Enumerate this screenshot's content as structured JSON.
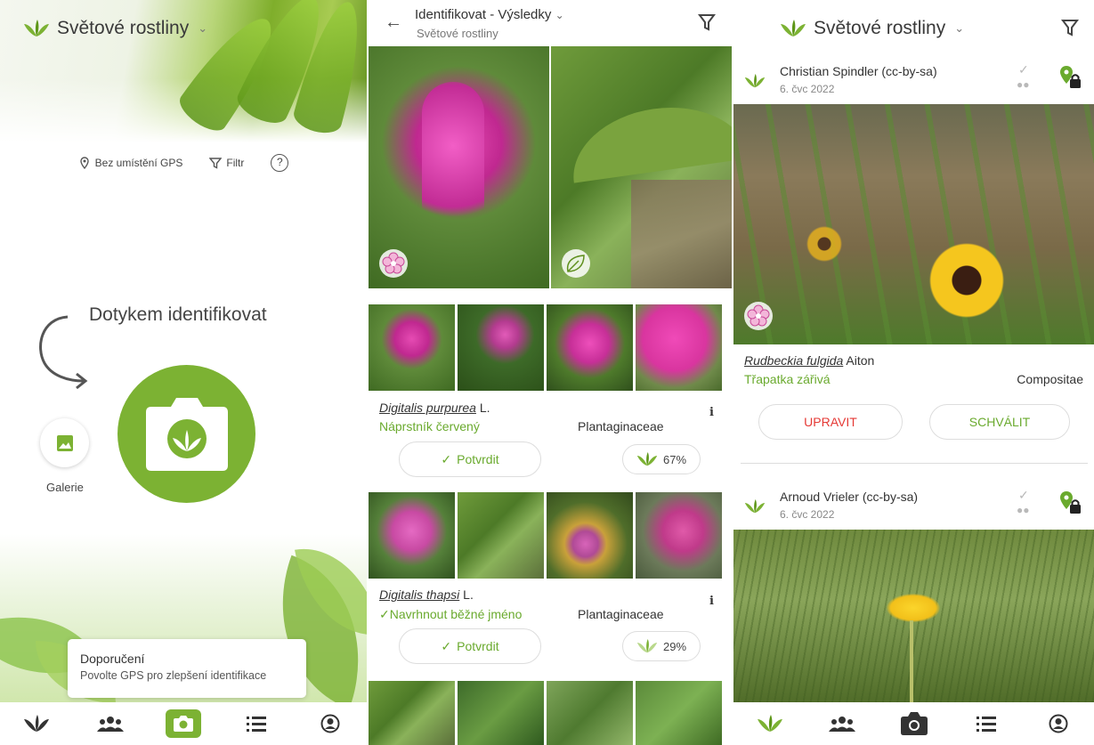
{
  "colors": {
    "accent": "#7cb233",
    "accent_text": "#6aaa2e",
    "danger": "#e53935"
  },
  "screen1": {
    "header": {
      "title": "Světové rostliny",
      "dropdown_icon": "chevron-down-icon"
    },
    "toolbar": {
      "gps_label": "Bez umístění GPS",
      "filter_label": "Filtr",
      "help_icon": "help-circle-icon"
    },
    "hint": "Dotykem identifikovat",
    "gallery_label": "Galerie",
    "toast": {
      "title": "Doporučení",
      "message": "Povolte GPS pro zlepšení identifikace"
    },
    "nav": [
      "plants-icon",
      "community-icon",
      "camera-icon",
      "list-icon",
      "profile-icon"
    ]
  },
  "screen2": {
    "header": {
      "title": "Identifikovat - Výsledky",
      "subtitle": "Světové rostliny"
    },
    "results": [
      {
        "scientific": "Digitalis purpurea",
        "author": "L.",
        "common": "Náprstník červený",
        "family": "Plantaginaceae",
        "confirm": "Potvrdit",
        "score": "67%"
      },
      {
        "scientific": "Digitalis thapsi",
        "author": "L.",
        "common": "Navrhnout běžné jméno",
        "family": "Plantaginaceae",
        "confirm": "Potvrdit",
        "score": "29%"
      }
    ]
  },
  "screen3": {
    "header": {
      "title": "Světové rostliny"
    },
    "observations": [
      {
        "author": "Christian Spindler (cc-by-sa)",
        "date": "6. čvc 2022",
        "scientific": "Rudbeckia fulgida",
        "sci_author": "Aiton",
        "common": "Třapatka zářivá",
        "family": "Compositae",
        "edit": "UPRAVIT",
        "approve": "SCHVÁLIT"
      },
      {
        "author": "Arnoud Vrieler (cc-by-sa)",
        "date": "6. čvc 2022"
      }
    ]
  }
}
